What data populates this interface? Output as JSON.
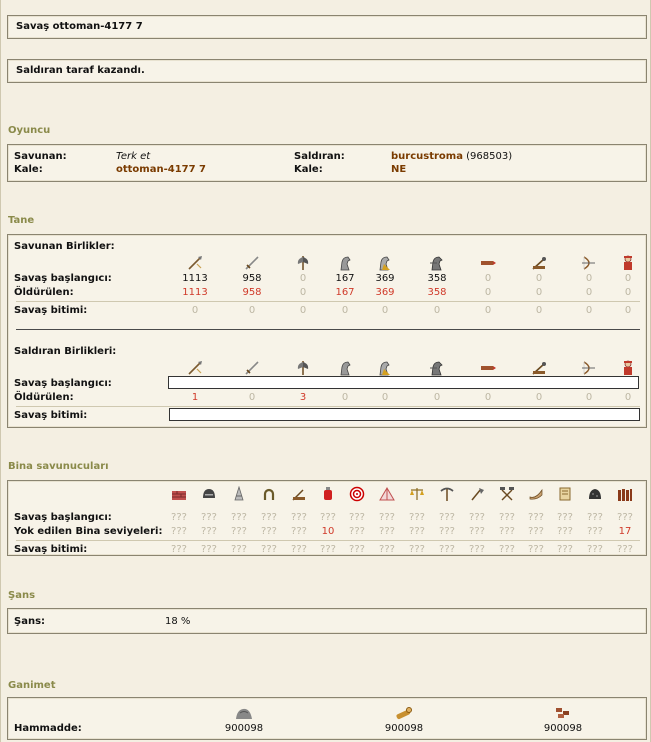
{
  "battle_title": "Savaş ottoman-4177 7",
  "result": "Saldıran taraf kazandı.",
  "sections": {
    "player": "Oyuncu",
    "units": "Tane",
    "defenders": "Bina savunucuları",
    "chance": "Şans",
    "loot": "Ganimet"
  },
  "player": {
    "defender_label": "Savunan:",
    "defender_name": "Terk et",
    "defender_castle_label": "Kale:",
    "defender_castle": "ottoman-4177 7",
    "attacker_label": "Saldıran:",
    "attacker_name": "burcustroma",
    "attacker_points": "(968503)",
    "attacker_castle_label": "Kale:",
    "attacker_castle": "NE"
  },
  "defender_units": {
    "header": "Savunan Birlikler:",
    "start_label": "Savaş başlangıcı:",
    "killed_label": "Öldürülen:",
    "end_label": "Savaş bitimi:",
    "start": [
      "1113",
      "958",
      "0",
      "167",
      "369",
      "358",
      "0",
      "0",
      "0",
      "0"
    ],
    "killed": [
      "1113",
      "958",
      "0",
      "167",
      "369",
      "358",
      "0",
      "0",
      "0",
      "0"
    ],
    "end": [
      "0",
      "0",
      "0",
      "0",
      "0",
      "0",
      "0",
      "0",
      "0",
      "0"
    ]
  },
  "attacker_units": {
    "header": "Saldıran Birlikleri:",
    "start_label": "Savaş başlangıcı:",
    "killed_label": "Öldürülen:",
    "end_label": "Savaş bitimi:",
    "killed": [
      "1",
      "0",
      "3",
      "0",
      "0",
      "0",
      "0",
      "0",
      "0",
      "0"
    ]
  },
  "unit_icons": [
    "spear-icon",
    "sword-icon",
    "axe-icon",
    "scout-horse-icon",
    "light-cavalry-icon",
    "heavy-cavalry-icon",
    "ram-icon",
    "catapult-icon",
    "archer-icon",
    "knight-icon"
  ],
  "buildings": {
    "start_label": "Savaş başlangıcı:",
    "destroyed_label": "Yok edilen Bina seviyeleri:",
    "end_label": "Savaş bitimi:",
    "icons": [
      "wall-icon",
      "helmet-icon",
      "tower-icon",
      "horseshoe-icon",
      "siege-icon",
      "potion-icon",
      "target-icon",
      "tent-icon",
      "scales-icon",
      "pickaxe-icon",
      "axe-tool-icon",
      "hammers-icon",
      "horn-icon",
      "scroll-icon",
      "ore-icon",
      "palisade-icon"
    ],
    "start": [
      "???",
      "???",
      "???",
      "???",
      "???",
      "???",
      "???",
      "???",
      "???",
      "???",
      "???",
      "???",
      "???",
      "???",
      "???",
      "???"
    ],
    "destroyed": [
      "???",
      "???",
      "???",
      "???",
      "???",
      "10",
      "???",
      "???",
      "???",
      "???",
      "???",
      "???",
      "???",
      "???",
      "???",
      "17"
    ],
    "end": [
      "???",
      "???",
      "???",
      "???",
      "???",
      "???",
      "???",
      "???",
      "???",
      "???",
      "???",
      "???",
      "???",
      "???",
      "???",
      "???"
    ]
  },
  "chance": {
    "label": "Şans:",
    "value": "18 %"
  },
  "loot": {
    "label": "Hammadde:",
    "items": [
      {
        "icon": "stone-icon",
        "value": "900098"
      },
      {
        "icon": "wood-icon",
        "value": "900098"
      },
      {
        "icon": "iron-icon",
        "value": "900098"
      }
    ]
  },
  "colors": {
    "section_heading": "#8a8a4a",
    "link": "#7a3b00",
    "killed": "#d03a2a",
    "zero": "#bdb7a4"
  }
}
